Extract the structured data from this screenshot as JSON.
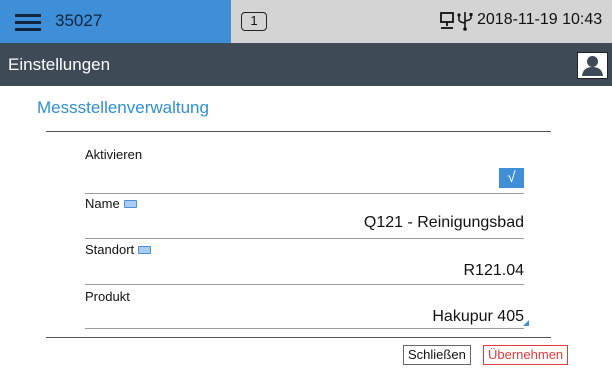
{
  "topbar": {
    "device_id": "35027",
    "message_count": "1",
    "datetime": "2018-11-19 10:43"
  },
  "titlebar": {
    "title": "Einstellungen"
  },
  "section": {
    "title": "Messstellenverwaltung"
  },
  "fields": {
    "activate": {
      "label": "Aktivieren",
      "checked": true,
      "check_glyph": "√"
    },
    "name": {
      "label": "Name",
      "value": "Q121 - Reinigungsbad"
    },
    "location": {
      "label": "Standort",
      "value": "R121.04"
    },
    "product": {
      "label": "Produkt",
      "value": "Hakupur 405"
    }
  },
  "buttons": {
    "close": "Schließen",
    "apply": "Übernehmen"
  },
  "colors": {
    "accent_blue": "#3f8fd8",
    "titlebar": "#3f4a57",
    "statusbar_gray": "#d4d4d4",
    "apply_red": "#e23b3b"
  },
  "icons": [
    "menu-icon",
    "network-icon",
    "usb-icon",
    "user-icon",
    "keyboard-icon",
    "checkbox-check-icon",
    "dropdown-corner-icon"
  ]
}
